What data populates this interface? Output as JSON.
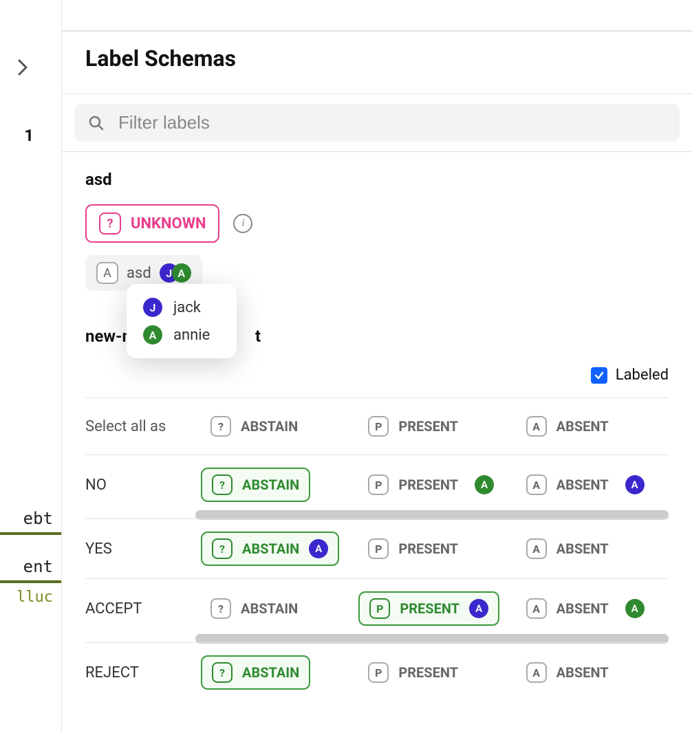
{
  "left": {
    "count": "1",
    "clipped": [
      {
        "text": "ebt"
      },
      {
        "text": "ent",
        "sub": "lluc"
      }
    ]
  },
  "title": "Label Schemas",
  "filter": {
    "placeholder": "Filter labels"
  },
  "schema1": {
    "name": "asd",
    "unknown_label": "UNKNOWN",
    "unknown_glyph": "?",
    "sub_glyph": "A",
    "sub_label": "asd",
    "avatars": [
      {
        "initial": "J",
        "color": "blue"
      },
      {
        "initial": "A",
        "color": "green"
      }
    ]
  },
  "popover": {
    "users": [
      {
        "initial": "J",
        "color": "blue",
        "name": "jack"
      },
      {
        "initial": "A",
        "color": "green",
        "name": "annie"
      }
    ]
  },
  "schema2": {
    "name_visible": "new-n",
    "name_tail": "t",
    "labeled_text": "Labeled",
    "labeled_checked": true,
    "select_all_label": "Select all as",
    "options": {
      "abstain": {
        "glyph": "?",
        "label": "ABSTAIN"
      },
      "present": {
        "glyph": "P",
        "label": "PRESENT"
      },
      "absent": {
        "glyph": "A",
        "label": "ABSENT"
      }
    },
    "rows": [
      {
        "label": "NO",
        "selected": "abstain",
        "votes": {
          "present": [
            {
              "initial": "A",
              "color": "green"
            }
          ],
          "absent": [
            {
              "initial": "A",
              "color": "blue"
            }
          ]
        },
        "has_scroll": true
      },
      {
        "label": "YES",
        "selected": "abstain",
        "votes": {
          "abstain": [
            {
              "initial": "A",
              "color": "blue"
            }
          ]
        },
        "has_scroll": false
      },
      {
        "label": "ACCEPT",
        "selected": "present",
        "votes": {
          "present": [
            {
              "initial": "A",
              "color": "blue"
            }
          ],
          "absent": [
            {
              "initial": "A",
              "color": "green"
            }
          ]
        },
        "has_scroll": true
      },
      {
        "label": "REJECT",
        "selected": "abstain",
        "votes": {},
        "has_scroll": false
      }
    ]
  }
}
